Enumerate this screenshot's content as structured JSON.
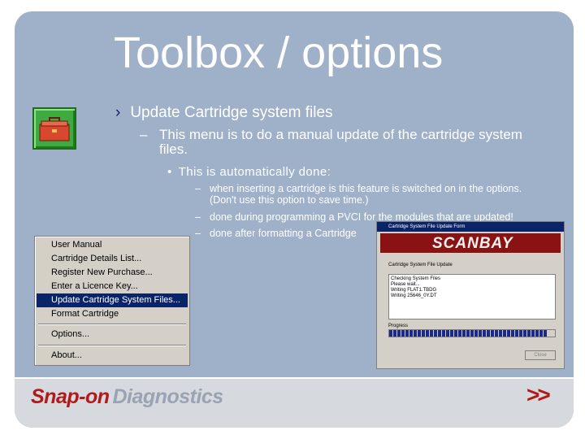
{
  "slide": {
    "title": "Toolbox / options",
    "bullet1": "Update Cartridge system files",
    "bullet2_line1": "This menu is to do a manual update of the cartridge system",
    "bullet2_line2": "files.",
    "bullet3": "This is automatically done:",
    "sub1_line1": "when inserting a cartridge is this feature is switched on in the options.",
    "sub1_line2": "(Don't use this option to save time.)",
    "sub2": "done during programming a PVCI for the modules that are updated!",
    "sub3": "done after formatting a Cartridge",
    "dash": "–",
    "bullet_marker": "›",
    "dot": "•"
  },
  "menu": {
    "items": [
      "User Manual",
      "Cartridge Details List...",
      "Register New Purchase...",
      "Enter a Licence Key...",
      "Update Cartridge System Files...",
      "Format Cartridge",
      "Options...",
      "About..."
    ],
    "selected_index": 4
  },
  "dialog": {
    "title": "Cartridge System File Update Form",
    "banner_logo": "SCANBAY",
    "heading": "Cartridge System File Update",
    "list": [
      "Checking System Files",
      "Please wait...",
      "Writing FLAT1.TBDG",
      "Writing 25646_0Y.DT"
    ],
    "progress_label": "Progress",
    "progress_fraction": 0.95,
    "close_label": "Close"
  },
  "footer": {
    "brand_part1": "Snap-on",
    "brand_part2": "Diagnostics",
    "next_label": ">>"
  },
  "colors": {
    "background": "#9fb0c9",
    "accent_red": "#b01a1a",
    "selection": "#0a246a"
  },
  "icons": [
    "toolbox-icon"
  ]
}
